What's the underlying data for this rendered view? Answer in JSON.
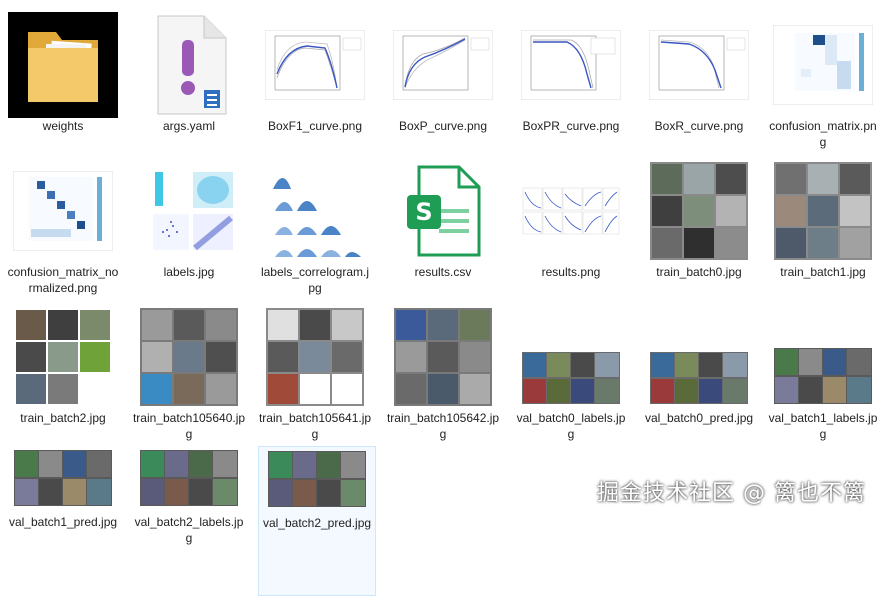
{
  "files": [
    {
      "name": "weights",
      "type": "folder"
    },
    {
      "name": "args.yaml",
      "type": "yaml-file"
    },
    {
      "name": "BoxF1_curve.png",
      "type": "curve"
    },
    {
      "name": "BoxP_curve.png",
      "type": "curve"
    },
    {
      "name": "BoxPR_curve.png",
      "type": "curve-pr"
    },
    {
      "name": "BoxR_curve.png",
      "type": "curve"
    },
    {
      "name": "confusion_matrix.png",
      "type": "matrix"
    },
    {
      "name": "confusion_matrix_normalized.png",
      "type": "matrix-norm"
    },
    {
      "name": "labels.jpg",
      "type": "labels"
    },
    {
      "name": "labels_correlogram.jpg",
      "type": "correlogram"
    },
    {
      "name": "results.csv",
      "type": "csv-file"
    },
    {
      "name": "results.png",
      "type": "results"
    },
    {
      "name": "train_batch0.jpg",
      "type": "photo-grid"
    },
    {
      "name": "train_batch1.jpg",
      "type": "photo-grid"
    },
    {
      "name": "train_batch2.jpg",
      "type": "photo-grid"
    },
    {
      "name": "train_batch105640.jpg",
      "type": "photo-grid"
    },
    {
      "name": "train_batch105641.jpg",
      "type": "photo-grid"
    },
    {
      "name": "train_batch105642.jpg",
      "type": "photo-grid"
    },
    {
      "name": "val_batch0_labels.jpg",
      "type": "photo-strip"
    },
    {
      "name": "val_batch0_pred.jpg",
      "type": "photo-strip"
    },
    {
      "name": "val_batch1_labels.jpg",
      "type": "photo-strip"
    },
    {
      "name": "val_batch1_pred.jpg",
      "type": "photo-strip"
    },
    {
      "name": "val_batch2_labels.jpg",
      "type": "photo-strip"
    },
    {
      "name": "val_batch2_pred.jpg",
      "type": "photo-strip",
      "selected": true
    }
  ],
  "watermark": "掘金技术社区 @ 篱也不篱",
  "colors": {
    "folder": "#f3c969",
    "yaml": "#9b59b6",
    "csv": "#1f9d55",
    "chart_blue": "#3a56c4",
    "selection_border": "#cce8ff"
  }
}
